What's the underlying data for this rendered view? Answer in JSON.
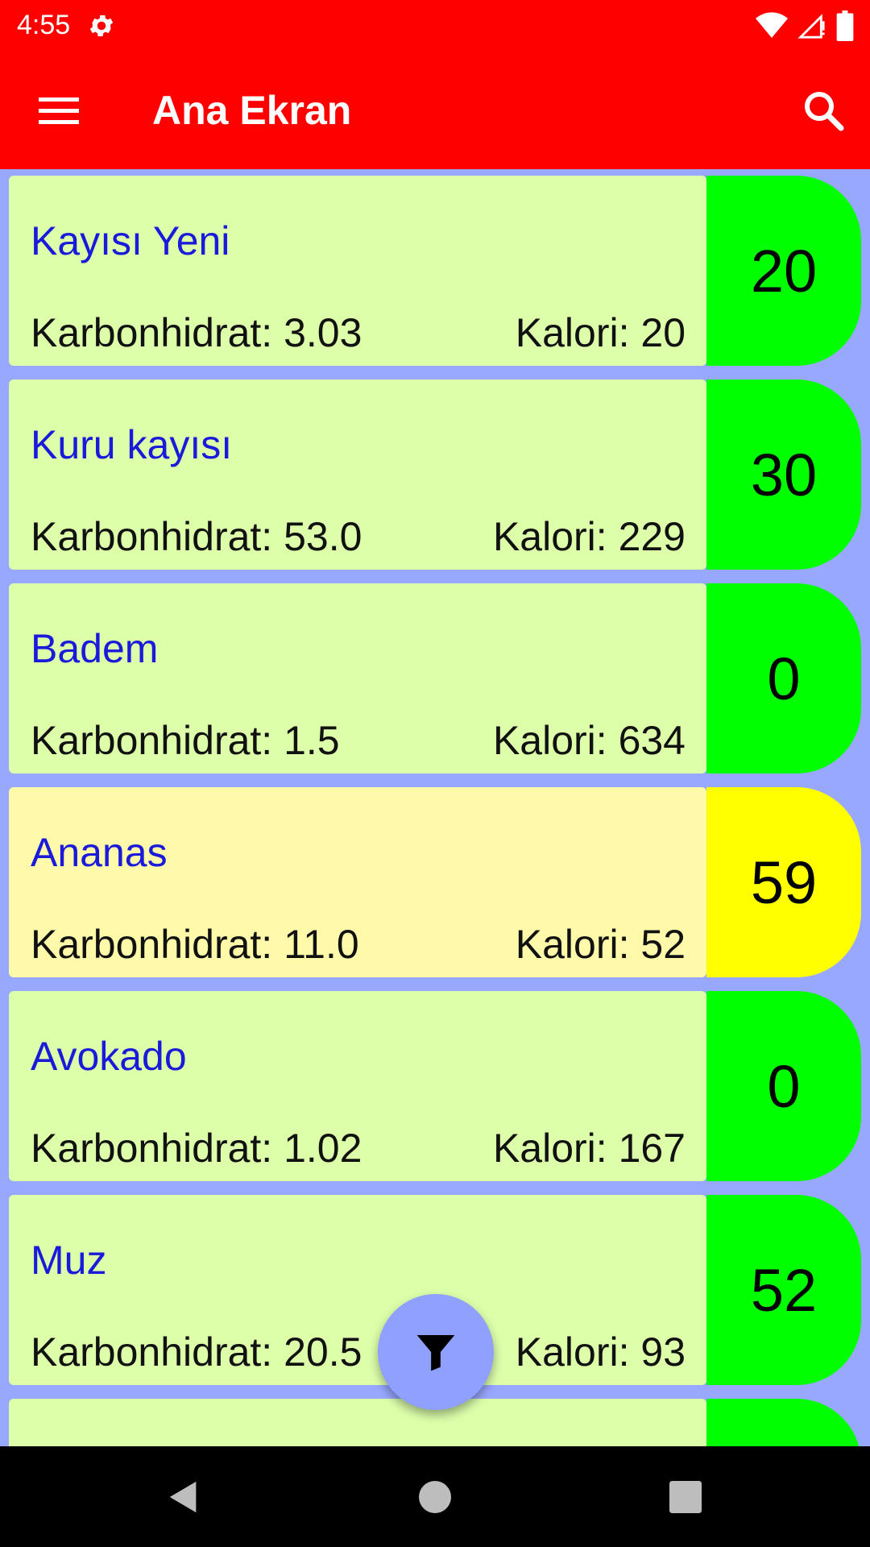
{
  "status_bar": {
    "time": "4:55",
    "icons": [
      "settings-icon",
      "wifi-icon",
      "signal-icon",
      "battery-icon"
    ]
  },
  "app_bar": {
    "title": "Ana Ekran",
    "menu_icon": "hamburger-menu-icon",
    "search_icon": "search-icon",
    "color": "#ff0000"
  },
  "foods": [
    {
      "name": "Kayısı Yeni",
      "carb": "Karbonhidrat: 3.03",
      "kcal": "Kalori: 20",
      "gi": "20",
      "card_color": "#ddffaa",
      "badge_color": "#00ff00"
    },
    {
      "name": "Kuru kayısı",
      "carb": "Karbonhidrat: 53.0",
      "kcal": "Kalori: 229",
      "gi": "30",
      "card_color": "#ddffaa",
      "badge_color": "#00ff00"
    },
    {
      "name": "Badem",
      "carb": "Karbonhidrat: 1.5",
      "kcal": "Kalori: 634",
      "gi": "0",
      "card_color": "#ddffaa",
      "badge_color": "#00ff00"
    },
    {
      "name": "Ananas",
      "carb": "Karbonhidrat: 11.0",
      "kcal": "Kalori: 52",
      "gi": "59",
      "card_color": "#fffaaa",
      "badge_color": "#ffff00"
    },
    {
      "name": "Avokado",
      "carb": "Karbonhidrat: 1.02",
      "kcal": "Kalori: 167",
      "gi": "0",
      "card_color": "#ddffaa",
      "badge_color": "#00ff00"
    },
    {
      "name": "Muz",
      "carb": "Karbonhidrat: 20.5",
      "kcal": "Kalori: 93",
      "gi": "52",
      "card_color": "#ddffaa",
      "badge_color": "#00ff00"
    },
    {
      "name": "",
      "carb": "",
      "kcal": "",
      "gi": "",
      "card_color": "#ddffaa",
      "badge_color": "#00ff00"
    }
  ],
  "fab": {
    "icon": "filter-icon"
  },
  "nav_bar": {
    "icons": [
      "back-icon",
      "home-icon",
      "recents-icon"
    ]
  }
}
